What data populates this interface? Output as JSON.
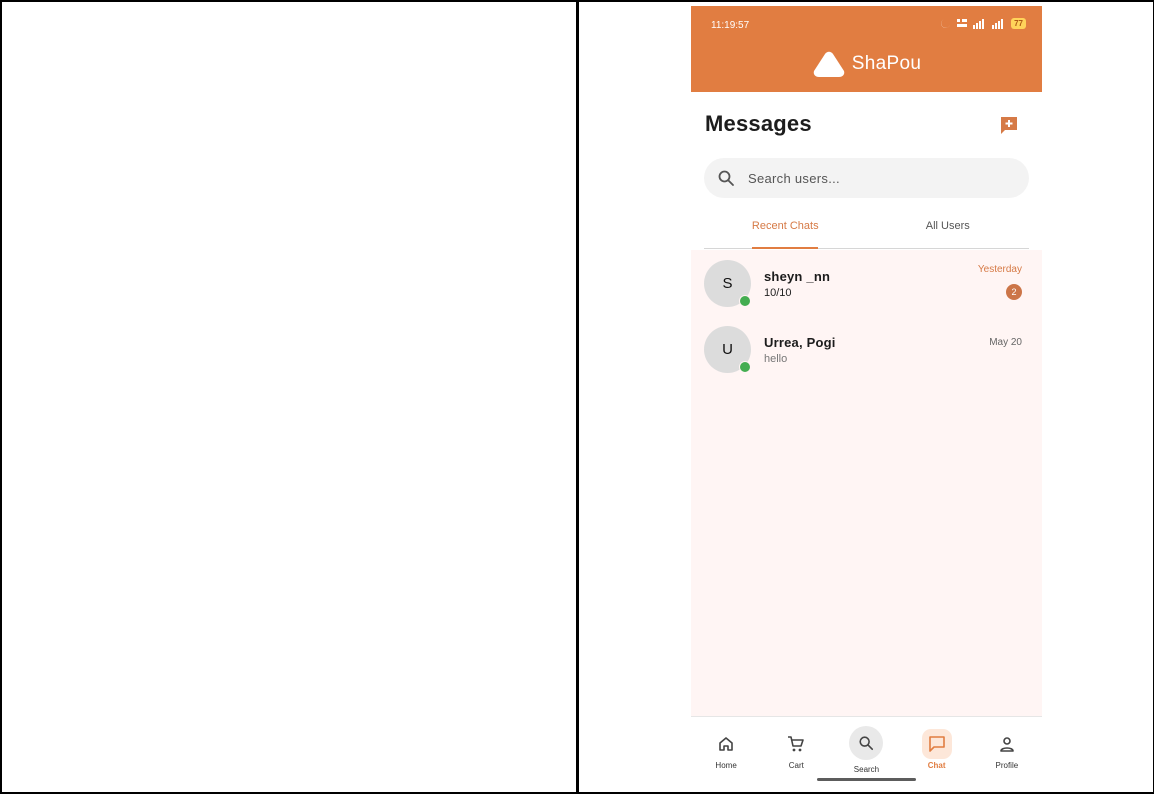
{
  "status_bar": {
    "time": "11:19:57",
    "battery": "77"
  },
  "app": {
    "name": "ShaPou"
  },
  "page": {
    "title": "Messages"
  },
  "search": {
    "placeholder": "Search users..."
  },
  "tabs": [
    {
      "label": "Recent Chats",
      "active": true
    },
    {
      "label": "All Users",
      "active": false
    }
  ],
  "chats": [
    {
      "initial": "S",
      "name": "sheyn _nn",
      "preview": "10/10",
      "time": "Yesterday",
      "unread": "2"
    },
    {
      "initial": "U",
      "name": "Urrea, Pogi",
      "preview": "hello",
      "time": "May 20"
    }
  ],
  "nav": {
    "items": [
      {
        "label": "Home",
        "icon": "home-icon"
      },
      {
        "label": "Cart",
        "icon": "cart-icon"
      },
      {
        "label": "Search",
        "icon": "search-icon"
      },
      {
        "label": "Chat",
        "icon": "chat-icon",
        "active": true
      },
      {
        "label": "Profile",
        "icon": "profile-icon"
      }
    ]
  },
  "colors": {
    "brand": "#e17d41",
    "online": "#43ad50",
    "list_background": "#fff5f4"
  }
}
